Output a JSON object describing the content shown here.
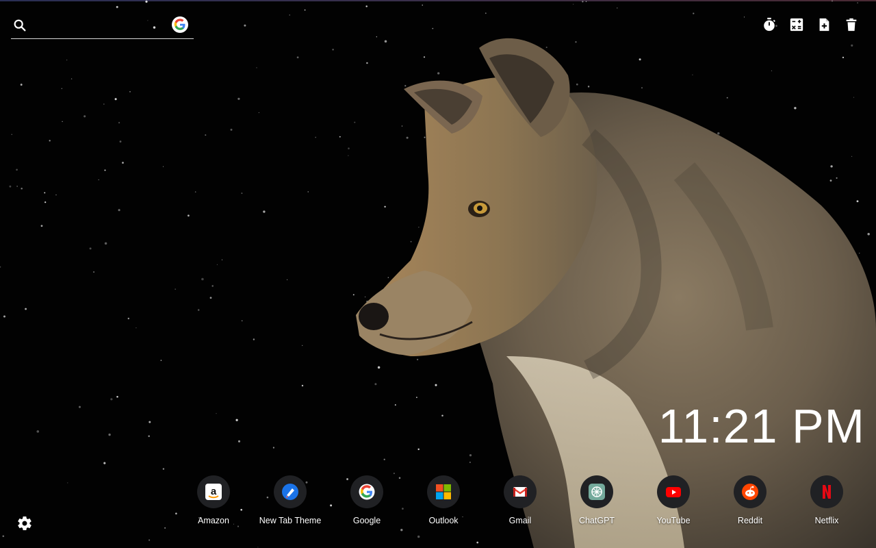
{
  "search": {
    "placeholder": "",
    "engine_icon": "google-icon"
  },
  "toolbar": [
    {
      "icon": "timer-icon"
    },
    {
      "icon": "calculator-icon"
    },
    {
      "icon": "add-note-icon"
    },
    {
      "icon": "trash-icon"
    }
  ],
  "clock": {
    "time": "11:21 PM"
  },
  "shortcuts": [
    {
      "label": "Amazon",
      "icon": "amazon-icon"
    },
    {
      "label": "New Tab Theme",
      "icon": "new-tab-theme-icon"
    },
    {
      "label": "Google",
      "icon": "google-icon"
    },
    {
      "label": "Outlook",
      "icon": "outlook-icon"
    },
    {
      "label": "Gmail",
      "icon": "gmail-icon"
    },
    {
      "label": "ChatGPT",
      "icon": "chatgpt-icon"
    },
    {
      "label": "YouTube",
      "icon": "youtube-icon"
    },
    {
      "label": "Reddit",
      "icon": "reddit-icon"
    },
    {
      "label": "Netflix",
      "icon": "netflix-icon"
    }
  ],
  "settings": {
    "icon": "gear-icon"
  },
  "colors": {
    "background": "#020202",
    "text": "#ffffff",
    "shortcut_circle": "#202124"
  }
}
